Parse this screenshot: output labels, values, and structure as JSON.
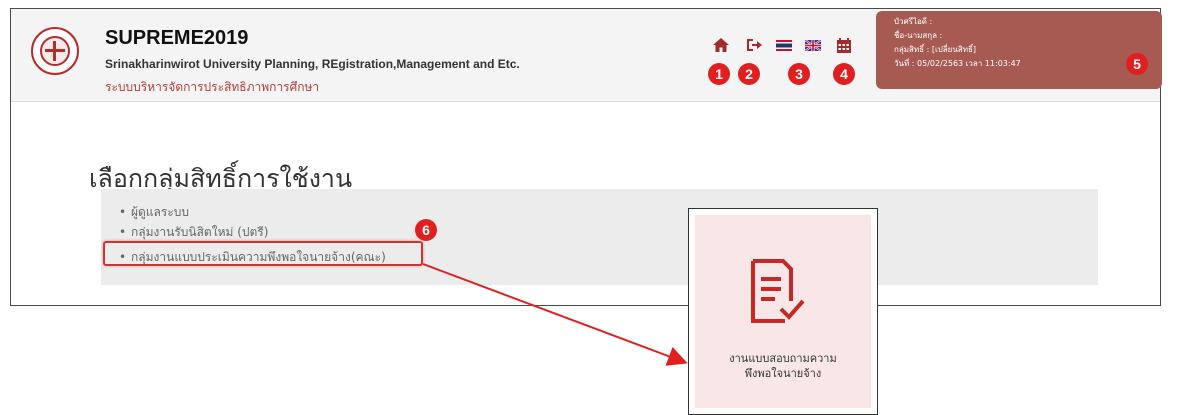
{
  "app": {
    "title": "SUPREME2019",
    "subtitle": "Srinakharinwirot University Planning, REgistration,Management and Etc.",
    "subtitle_th": "ระบบบริหารจัดการประสิทธิภาพการศึกษา"
  },
  "toolbar": {
    "icons": [
      "home-icon",
      "logout-icon",
      "thai-flag-icon",
      "uk-flag-icon",
      "calendar-icon"
    ]
  },
  "user": {
    "buasri_label": "บัวศรีไอดี :",
    "name_label": "ชื่อ-นามสกุล :",
    "group_label": "กลุ่มสิทธิ์ : [เปลี่ยนสิทธิ์]",
    "date_label": "วันที่ : 05/02/2563 เวลา 11:03:47"
  },
  "page": {
    "title": "เลือกกลุ่มสิทธิ์การใช้งาน"
  },
  "roles": [
    {
      "bullet": "•",
      "label": "ผู้ดูแลระบบ"
    },
    {
      "bullet": "•",
      "label": "กลุ่มงานรับนิสิตใหม่ (ปตรี)"
    },
    {
      "bullet": "•",
      "label": "กลุ่มงานแบบประเมินความพึงพอใจนายจ้าง(คณะ)"
    }
  ],
  "callouts": [
    "1",
    "2",
    "3",
    "4",
    "5",
    "6"
  ],
  "card": {
    "icon": "checklist-icon",
    "label_line1": "งานแบบสอบถามความ",
    "label_line2": "พึงพอใจนายจ้าง"
  },
  "colors": {
    "accent_red": "#e02020",
    "user_box": "#a65a52",
    "card_bg": "#f9e7e7",
    "icon_red": "#b32d2d"
  }
}
